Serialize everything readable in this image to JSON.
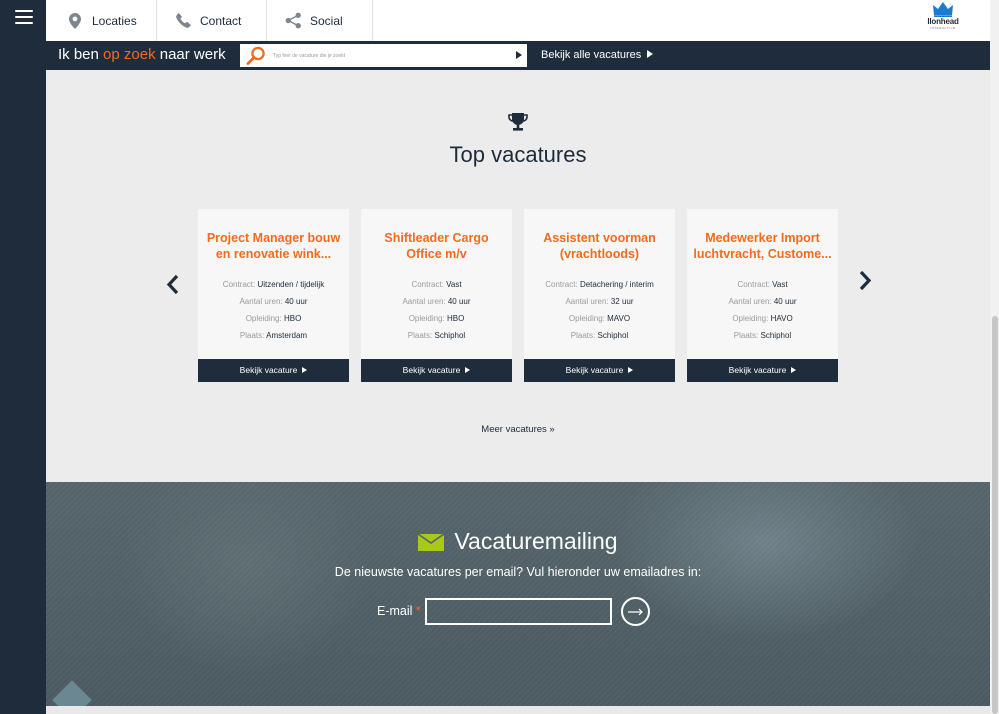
{
  "topnav": {
    "locaties": "Locaties",
    "contact": "Contact",
    "social": "Social"
  },
  "logo": {
    "text": "llonhead",
    "sub": "INTERACTIVE"
  },
  "search": {
    "heading_pre": "Ik ben ",
    "heading_accent": "op zoek",
    "heading_post": " naar werk",
    "placeholder": "Typ hier de vacature die je zoekt",
    "all_label": "Bekijk alle vacatures"
  },
  "main": {
    "title": "Top vacatures",
    "more_label": "Meer vacatures »",
    "labels": {
      "contract": "Contract:",
      "hours": "Aantal uren:",
      "education": "Opleiding:",
      "place": "Plaats:"
    },
    "button_label": "Bekijk vacature",
    "cards": [
      {
        "title": "Project Manager bouw en renovatie wink...",
        "contract": "Uitzenden / tijdelijk",
        "hours": "40 uur",
        "education": "HBO",
        "place": "Amsterdam"
      },
      {
        "title": "Shiftleader Cargo Office m/v",
        "contract": "Vast",
        "hours": "40 uur",
        "education": "HBO",
        "place": "Schiphol"
      },
      {
        "title": "Assistent voorman (vrachtloods)",
        "contract": "Detachering / interim",
        "hours": "32 uur",
        "education": "MAVO",
        "place": "Schiphol"
      },
      {
        "title": "Medewerker Import luchtvracht, Custome...",
        "contract": "Vast",
        "hours": "40 uur",
        "education": "HAVO",
        "place": "Schiphol"
      }
    ]
  },
  "newsletter": {
    "title": "Vacaturemailing",
    "subtitle": "De nieuwste vacatures per email? Vul hieronder uw emailadres in:",
    "email_label": "E-mail",
    "required_mark": "*"
  },
  "colors": {
    "navy": "#1e2c3c",
    "accent_orange": "#f26b21",
    "mail_green": "#a8c81a",
    "background": "#ececec"
  },
  "icons": [
    "menu-icon",
    "location-pin-icon",
    "phone-icon",
    "share-icon",
    "crown-icon",
    "search-icon",
    "trophy-icon",
    "chevron-left-icon",
    "chevron-right-icon",
    "mail-icon",
    "arrow-right-icon"
  ]
}
